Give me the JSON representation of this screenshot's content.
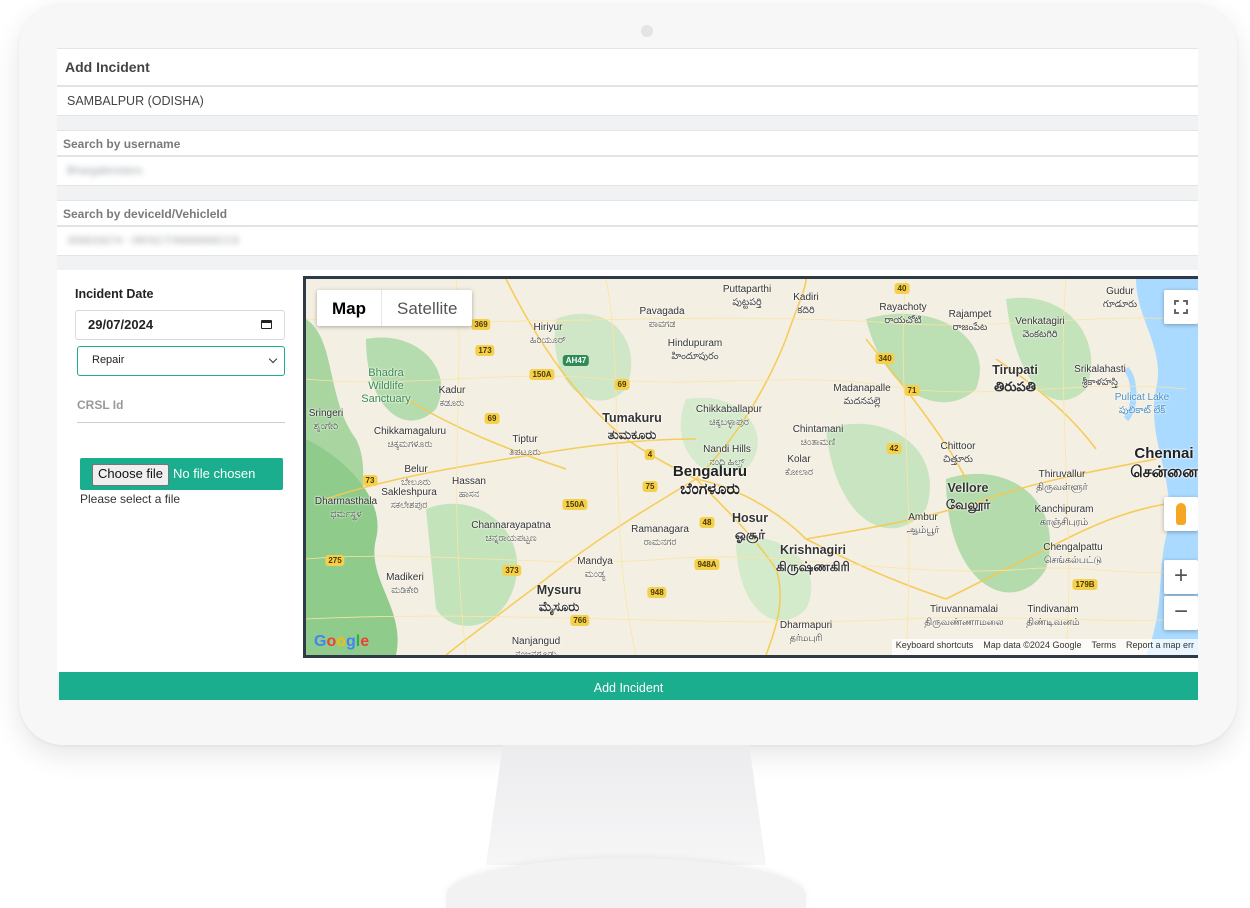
{
  "form": {
    "heading": "Add Incident",
    "region": "SAMBALPUR (ODISHA)",
    "username_label": "Search by username",
    "username_value": "Bhargabmotors",
    "device_label": "Search by deviceId/VehicleId",
    "device_value": "359633074 - 0R/SCT/9999999CC9",
    "incident_date_label": "Incident Date",
    "incident_date_value": "29/07/2024",
    "incident_type_value": "Repair",
    "crsl_placeholder": "CRSL Id",
    "file_button": "Choose file",
    "file_status": "No file chosen",
    "file_hint": "Please select a file",
    "submit_label": "Add Incident"
  },
  "map": {
    "map_type_map": "Map",
    "map_type_satellite": "Satellite",
    "zoom_in": "+",
    "zoom_out": "−",
    "google_logo": "Google",
    "attribution": [
      "Keyboard shortcuts",
      "Map data ©2024 Google",
      "Terms",
      "Report a map err"
    ],
    "places": [
      {
        "en": "Bengaluru",
        "local": "ಬೆಂಗಳೂರು",
        "size": "big"
      },
      {
        "en": "Chennai",
        "local": "சென்னை",
        "size": "big"
      },
      {
        "en": "Tumakuru",
        "local": "ತುಮಕೂರು",
        "size": "mid"
      },
      {
        "en": "Mysuru",
        "local": "ಮೈಸೂರು",
        "size": "mid"
      },
      {
        "en": "Hosur",
        "local": "ஓசூர்",
        "size": "mid"
      },
      {
        "en": "Krishnagiri",
        "local": "கிருஷ்ணகிரி",
        "size": "mid"
      },
      {
        "en": "Vellore",
        "local": "வேலூர்",
        "size": "mid"
      },
      {
        "en": "Tirupati",
        "local": "తిరుపతి",
        "size": "mid"
      },
      {
        "en": "Hiriyur",
        "local": "ಹಿರಿಯೂರ್",
        "size": "small"
      },
      {
        "en": "Pavagada",
        "local": "ಪಾವಗಡ",
        "size": "small"
      },
      {
        "en": "Puttaparthi",
        "local": "పుట్టపర్తి",
        "size": "small"
      },
      {
        "en": "Kadiri",
        "local": "కదిరి",
        "size": "small"
      },
      {
        "en": "Rayachoty",
        "local": "రాయచోటి",
        "size": "small"
      },
      {
        "en": "Rajampet",
        "local": "రాజంపేట",
        "size": "small"
      },
      {
        "en": "Gudur",
        "local": "గూడూరు",
        "size": "small"
      },
      {
        "en": "Venkatagiri",
        "local": "వెంకటగిరి",
        "size": "small"
      },
      {
        "en": "Hindupuram",
        "local": "హిందూపురం",
        "size": "small"
      },
      {
        "en": "Madanapalle",
        "local": "మదనపల్లె",
        "size": "small"
      },
      {
        "en": "Srikalahasti",
        "local": "శ్రీకాళహస్తి",
        "size": "small"
      },
      {
        "en": "Kadur",
        "local": "ಕಡೂರು",
        "size": "small"
      },
      {
        "en": "Sringeri",
        "local": "ಶೃಂಗೇರಿ",
        "size": "small"
      },
      {
        "en": "Chikkamagaluru",
        "local": "ಚಿಕ್ಕಮಗಳೂರು",
        "size": "small"
      },
      {
        "en": "Tiptur",
        "local": "ತಿಪಟೂರು",
        "size": "small"
      },
      {
        "en": "Chikkaballapur",
        "local": "ಚಿಕ್ಕಬಳ್ಳಾಪುರ",
        "size": "small"
      },
      {
        "en": "Chintamani",
        "local": "ಚಿಂತಾಮಣಿ",
        "size": "small"
      },
      {
        "en": "Nandi Hills",
        "local": "ನಂದಿ ಹಿಲ್ಸ್",
        "size": "small"
      },
      {
        "en": "Kolar",
        "local": "ಕೋಲಾರ",
        "size": "small"
      },
      {
        "en": "Chittoor",
        "local": "చిత్తూరు",
        "size": "small"
      },
      {
        "en": "Belur",
        "local": "ಬೇಲೂರು",
        "size": "small"
      },
      {
        "en": "Hassan",
        "local": "ಹಾಸನ",
        "size": "small"
      },
      {
        "en": "Sakleshpura",
        "local": "ಸಕಲೇಶಪುರ",
        "size": "small"
      },
      {
        "en": "Dharmasthala",
        "local": "ಧರ್ಮಸ್ಥಳ",
        "size": "small"
      },
      {
        "en": "Thiruvallur",
        "local": "திருவள்ளூர்",
        "size": "small"
      },
      {
        "en": "Kanchipuram",
        "local": "காஞ்சிபுரம்",
        "size": "small"
      },
      {
        "en": "Ambur",
        "local": "ஆம்பூர்",
        "size": "small"
      },
      {
        "en": "Chengalpattu",
        "local": "செங்கல்பட்டு",
        "size": "small"
      },
      {
        "en": "Channarayapatna",
        "local": "ಚನ್ನರಾಯಪಟ್ಟಣ",
        "size": "small"
      },
      {
        "en": "Ramanagara",
        "local": "ರಾಮನಗರ",
        "size": "small"
      },
      {
        "en": "Mandya",
        "local": "ಮಂಡ್ಯ",
        "size": "small"
      },
      {
        "en": "Madikeri",
        "local": "ಮಡಿಕೇರಿ",
        "size": "small"
      },
      {
        "en": "Nanjangud",
        "local": "ನಂಜನಗೂಡು",
        "size": "small"
      },
      {
        "en": "Dharmapuri",
        "local": "தர்மபுரி",
        "size": "small"
      },
      {
        "en": "Tiruvannamalai",
        "local": "திருவண்ணாமலை",
        "size": "small"
      },
      {
        "en": "Tindivanam",
        "local": "திண்டிவனம்",
        "size": "small"
      },
      {
        "en": "Bhadra Wildlife Sanctuary",
        "local": "",
        "size": "green"
      },
      {
        "en": "Pulicat Lake",
        "local": "పులికాట్ లేక్",
        "size": "water"
      }
    ],
    "highways": [
      "40",
      "369",
      "173",
      "150A",
      "AH47",
      "69",
      "340",
      "71",
      "69",
      "4",
      "75",
      "48",
      "73",
      "150A",
      "948A",
      "948",
      "766",
      "275",
      "373",
      "179B",
      "42"
    ]
  }
}
